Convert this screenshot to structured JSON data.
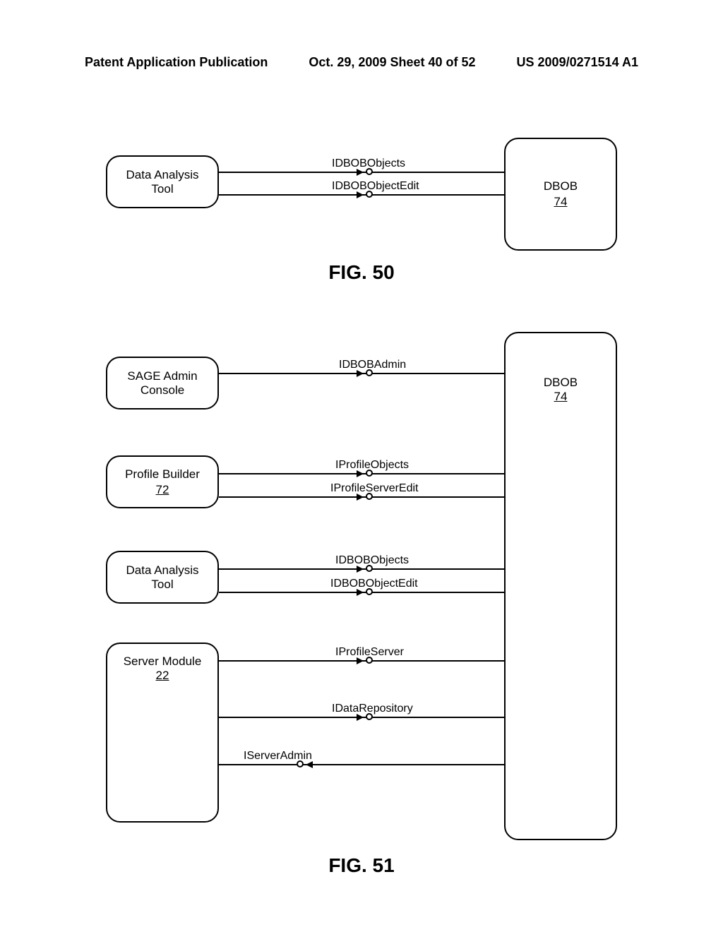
{
  "header": {
    "left": "Patent Application Publication",
    "center": "Oct. 29, 2009  Sheet 40 of 52",
    "right": "US 2009/0271514 A1"
  },
  "fig50": {
    "label": "FIG. 50",
    "left_box": "Data Analysis\nTool",
    "right_box": "DBOB",
    "right_ref": "74",
    "interfaces": [
      "IDBOBObjects",
      "IDBOBObjectEdit"
    ]
  },
  "fig51": {
    "label": "FIG. 51",
    "right_box": "DBOB",
    "right_ref": "74",
    "left_boxes": [
      {
        "label": "SAGE Admin\nConsole",
        "ref": ""
      },
      {
        "label": "Profile Builder",
        "ref": "72"
      },
      {
        "label": "Data Analysis\nTool",
        "ref": ""
      },
      {
        "label": "Server Module",
        "ref": "22"
      }
    ],
    "interfaces": [
      "IDBOBAdmin",
      "IProfileObjects",
      "IProfileServerEdit",
      "IDBOBObjects",
      "IDBOBObjectEdit",
      "IProfileServer",
      "IDataRepository",
      "IServerAdmin"
    ]
  }
}
